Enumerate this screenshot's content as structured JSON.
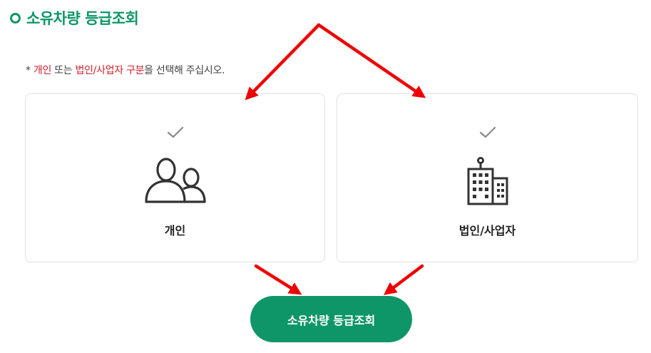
{
  "header": {
    "title": "소유차량 등급조회"
  },
  "notice": {
    "prefix": "* ",
    "personal": "개인",
    "or": " 또는 ",
    "corporate": "법인/사업자",
    "space": " ",
    "type": "구분",
    "suffix": "을 선택해 주십시오."
  },
  "options": {
    "personal": {
      "label": "개인",
      "icon": "people-icon",
      "check_icon": "check-icon"
    },
    "corporate": {
      "label": "법인/사업자",
      "icon": "building-icon",
      "check_icon": "check-icon"
    }
  },
  "submit": {
    "label": "소유차량 등급조회"
  },
  "colors": {
    "accent": "#0f9668",
    "highlight": "#d0202a",
    "annotation_arrow": "#ee0000",
    "check": "#888888",
    "icon": "#333333"
  }
}
